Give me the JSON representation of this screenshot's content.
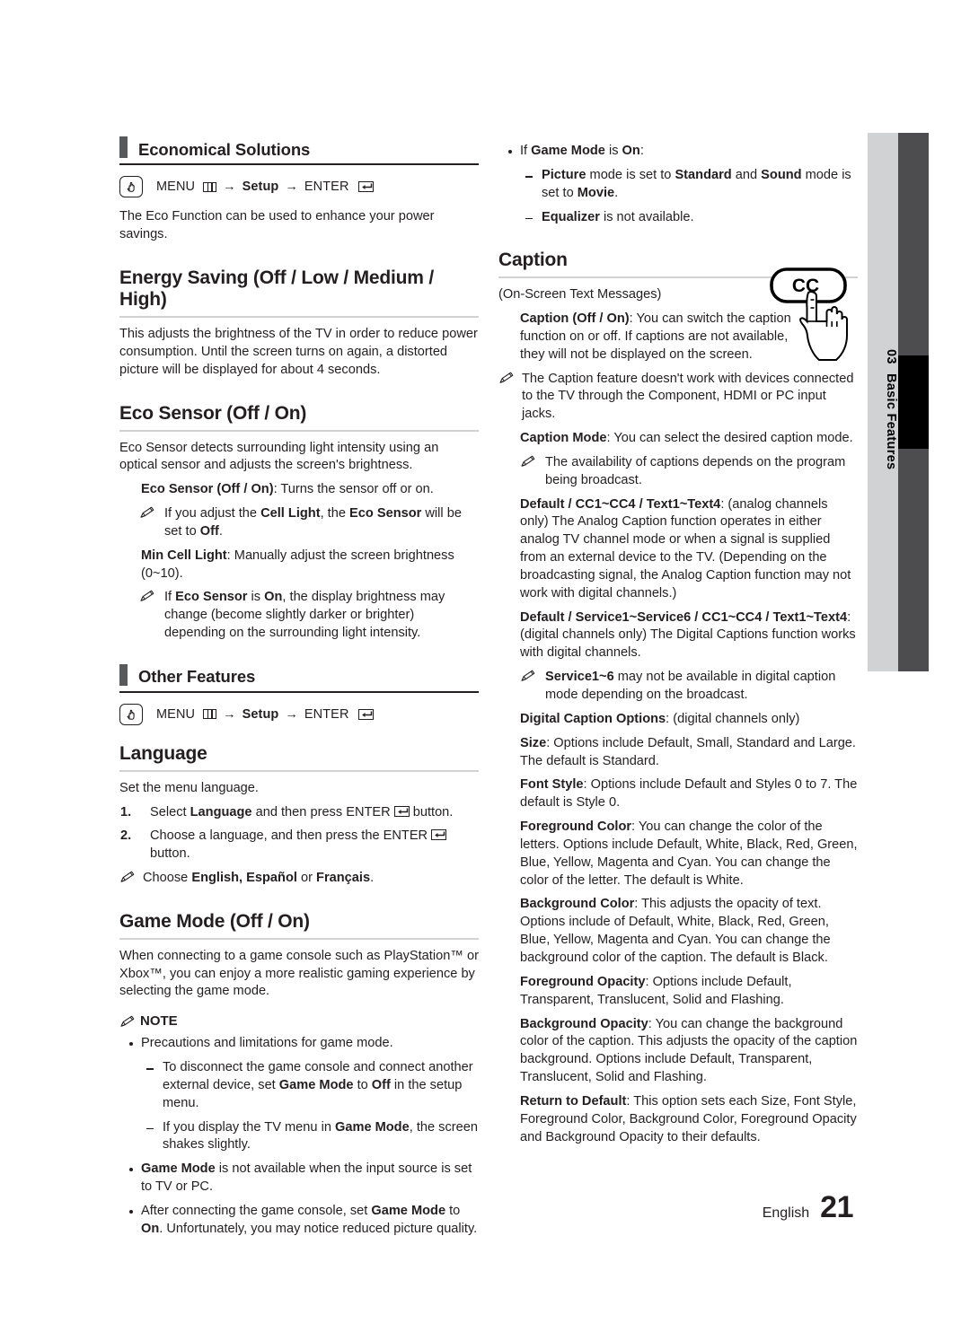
{
  "page": {
    "footer_language": "English",
    "footer_page_number": "21",
    "chapter_number": "03",
    "chapter_title": "Basic Features"
  },
  "icons": {
    "hand_press": "hand-press-icon",
    "menu_bars": "menu-bars-icon",
    "enter_return": "enter-return-icon",
    "note_pencil": "note-pencil-icon",
    "cc_button": "cc-button-illustration"
  },
  "left_column": {
    "section_band": {
      "title": "Economical Solutions"
    },
    "menu_path": {
      "menu_label": "MENU",
      "arrow1": "→",
      "setup_label": "Setup",
      "arrow2": "→",
      "enter_label": "ENTER"
    },
    "intro": "The Eco Function can be used to enhance your power savings.",
    "energy_saving": {
      "heading": "Energy Saving (Off / Low / Medium / High)",
      "body": "This adjusts the brightness of the TV in order to reduce power consumption. Until the screen turns on again, a distorted picture will be displayed for about 4 seconds."
    },
    "eco_sensor": {
      "heading": "Eco Sensor (Off / On)",
      "intro": "Eco Sensor detects surrounding light intensity using an optical sensor and adjusts the screen's brightness.",
      "items": [
        {
          "type": "square",
          "bold": "Eco Sensor (Off / On)",
          "text": ": Turns the sensor off or on."
        },
        {
          "type": "note",
          "text_html": "If you adjust the <b>Cell Light</b>, the <b>Eco Sensor</b> will be set to <b>Off</b>."
        },
        {
          "type": "square",
          "bold": "Min Cell Light",
          "text": ": Manually adjust the screen brightness (0~10)."
        },
        {
          "type": "note",
          "text_html": "If <b>Eco Sensor</b> is <b>On</b>, the display brightness may change (become slightly darker or brighter) depending on the surrounding light intensity."
        }
      ]
    },
    "section_band2": {
      "title": "Other Features"
    },
    "menu_path2": {
      "menu_label": "MENU",
      "arrow1": "→",
      "setup_label": "Setup",
      "arrow2": "→",
      "enter_label": "ENTER"
    },
    "language": {
      "heading": "Language",
      "intro": "Set the menu language.",
      "steps": [
        {
          "num": "1.",
          "html": "Select <b>Language</b> and then press ENTER<span class=\"icon-enter\" data-name=\"enter-return-icon\"><svg width=\"15\" height=\"10\" viewBox=\"0 0 15 10\"><path d=\"M12.5 1.5 L12.5 5.5 L4 5.5\" fill=\"none\" stroke=\"#231f20\" stroke-width=\"1.5\"/><path d=\"M5.5 3 L2.2 5.5 L5.5 8 Z\" fill=\"#231f20\"/></svg></span> button."
        },
        {
          "num": "2.",
          "html": "Choose a language, and then press the ENTER<span class=\"icon-enter\" data-name=\"enter-return-icon\"><svg width=\"15\" height=\"10\" viewBox=\"0 0 15 10\"><path d=\"M12.5 1.5 L12.5 5.5 L4 5.5\" fill=\"none\" stroke=\"#231f20\" stroke-width=\"1.5\"/><path d=\"M5.5 3 L2.2 5.5 L5.5 8 Z\" fill=\"#231f20\"/></svg></span> button."
        }
      ],
      "note": "Choose <b>English, Español</b> or <b>Français</b>."
    },
    "game_mode": {
      "heading": "Game Mode (Off / On)",
      "body": "When connecting to a game console such as PlayStation™ or Xbox™, you can enjoy a more realistic gaming experience by selecting the game mode.",
      "note_label": "NOTE",
      "items": [
        {
          "type": "dot",
          "html": "Precautions and limitations for game mode."
        },
        {
          "type": "dash",
          "html": "To disconnect the game console and connect another external device, set <b>Game Mode</b> to <b>Off</b> in the setup menu."
        },
        {
          "type": "dash",
          "html": "If you display the TV menu in <b>Game Mode</b>, the screen shakes slightly."
        },
        {
          "type": "dot",
          "html": "<b>Game Mode</b> is not available when the input source is set to TV or PC."
        },
        {
          "type": "dot",
          "html": "After connecting the game console, set <b>Game Mode</b> to <b>On</b>. Unfortunately, you may notice reduced picture quality."
        }
      ]
    }
  },
  "right_column": {
    "game_mode_continued": [
      {
        "type": "dot",
        "html": "If <b>Game Mode</b> is <b>On</b>:"
      },
      {
        "type": "dash",
        "html": "<b>Picture</b> mode is set to <b>Standard</b> and <b>Sound</b> mode is set to <b>Movie</b>."
      },
      {
        "type": "dash",
        "html": "<b>Equalizer</b> is not available."
      }
    ],
    "caption": {
      "heading": "Caption",
      "subtitle": "(On-Screen Text Messages)",
      "items": [
        {
          "type": "square",
          "html": "<b>Caption (Off / On)</b>: You can switch the caption function on or off. If captions are not available, they will not be displayed on the screen.",
          "narrow": true
        },
        {
          "type": "note0",
          "html": "The Caption feature doesn't work with devices connected to the TV through the Component, HDMI or PC input jacks."
        },
        {
          "type": "square",
          "html": "<b>Caption Mode</b>: You can select the desired caption mode."
        },
        {
          "type": "note1",
          "html": "The availability of captions depends on the program being broadcast."
        },
        {
          "type": "plain",
          "html": "<b>Default / CC1~CC4 / Text1~Text4</b>: (analog channels only) The Analog Caption function operates in either analog TV channel mode or when a signal is supplied from an external device to the TV. (Depending on the broadcasting signal, the Analog Caption function may not work with digital channels.)"
        },
        {
          "type": "plain",
          "html": "<b>Default / Service1~Service6 / CC1~CC4 / Text1~Text4</b>: (digital channels only) The Digital Captions function works with digital channels."
        },
        {
          "type": "note1",
          "html": "<b>Service1~6</b> may not be available in digital caption mode depending on the broadcast."
        },
        {
          "type": "square",
          "html": "<b>Digital Caption Options</b>: (digital channels only)"
        },
        {
          "type": "plain",
          "html": "<b>Size</b>: Options include Default, Small, Standard and Large. The default is Standard."
        },
        {
          "type": "plain",
          "html": "<b>Font Style</b>: Options include Default and Styles 0 to 7. The default is Style 0."
        },
        {
          "type": "plain",
          "html": "<b>Foreground Color</b>: You can change the color of the letters. Options include Default, White, Black, Red, Green, Blue, Yellow, Magenta and Cyan. You can change the color of the letter. The default is White."
        },
        {
          "type": "plain",
          "html": "<b>Background Color</b>: This adjusts the opacity of text. Options include of Default, White, Black, Red, Green, Blue, Yellow, Magenta and Cyan. You can change the background color of the caption. The default is Black."
        },
        {
          "type": "plain",
          "html": "<b>Foreground Opacity</b>: Options include Default, Transparent, Translucent, Solid and Flashing."
        },
        {
          "type": "plain",
          "html": "<b>Background Opacity</b>: You can change the background color of the caption. This adjusts the opacity of the caption background. Options include Default, Transparent, Translucent, Solid and Flashing."
        },
        {
          "type": "plain",
          "html": "<b>Return to Default</b>: This option sets each Size, Font Style, Foreground Color, Background Color, Foreground Opacity and Background Opacity to their defaults."
        }
      ]
    },
    "cc_illustration_label": "CC"
  },
  "colors": {
    "text": "#231f20",
    "band_bar": "#58595b",
    "heading_rule": "#d0d2d3",
    "tab_light": "#d0d2d3",
    "tab_dark": "#4d4d4f",
    "tab_black": "#000000"
  }
}
